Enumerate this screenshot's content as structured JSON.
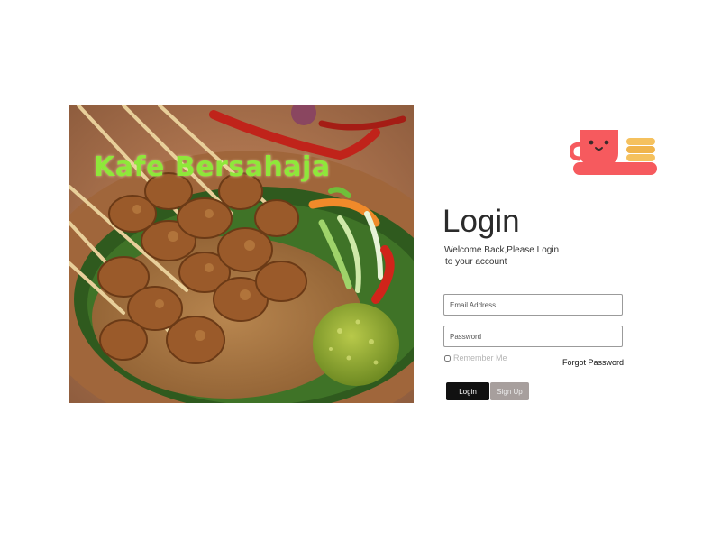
{
  "hero": {
    "brand_title": "Kafe Bersahaja"
  },
  "logo": {
    "icon": "cup-and-cookies-icon",
    "colors": {
      "cup": "#f65a5e",
      "cookies": "#f5c15e"
    }
  },
  "login": {
    "heading": "Login",
    "welcome_line1": "Welcome Back,Please Login",
    "welcome_line2": "to your account",
    "email_placeholder": "Email Address",
    "password_placeholder": "Password",
    "remember_label": "Remember Me",
    "forgot_label": "Forgot Password",
    "login_button": "Login",
    "signup_button": "Sign Up"
  },
  "colors": {
    "brand_green": "#8ee83a",
    "login_button_bg": "#111111",
    "signup_button_bg": "#a79f9d"
  }
}
